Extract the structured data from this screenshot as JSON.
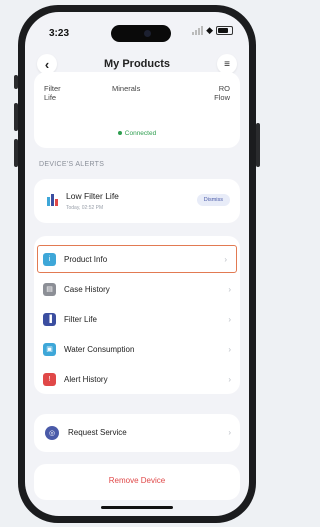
{
  "status": {
    "time": "3:23"
  },
  "header": {
    "title": "My Products",
    "back_icon": "chevron-left-icon",
    "menu_icon": "hamburger-icon"
  },
  "stats": {
    "filter_life": "Filter\nLife",
    "minerals": "Minerals",
    "ro_flow": "RO\nFlow"
  },
  "connection": {
    "status": "Connected",
    "color": "#2e9e4f"
  },
  "alerts": {
    "section_label": "DEVICE'S ALERTS",
    "items": [
      {
        "title": "Low Filter Life",
        "time": "Today, 02:52 PM",
        "dismiss_label": "Dismiss"
      }
    ]
  },
  "menu": {
    "items": [
      {
        "label": "Product Info",
        "icon": "info-icon",
        "color": "#3ea7d8",
        "selected": true
      },
      {
        "label": "Case History",
        "icon": "case-icon",
        "color": "#8c8f96"
      },
      {
        "label": "Filter Life",
        "icon": "filter-icon",
        "color": "#3b4ea0"
      },
      {
        "label": "Water Consumption",
        "icon": "water-icon",
        "color": "#3ea7d8"
      },
      {
        "label": "Alert History",
        "icon": "alert-icon",
        "color": "#e04848"
      }
    ]
  },
  "service": {
    "label": "Request Service"
  },
  "remove": {
    "label": "Remove Device",
    "color": "#e04848"
  },
  "accent": "#e27a52"
}
